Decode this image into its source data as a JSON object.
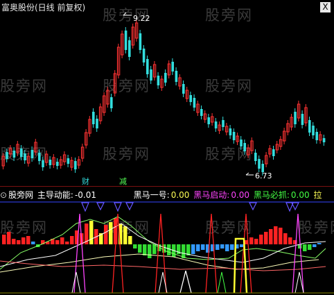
{
  "header": {
    "title": "富奥股份(日线 前复权)",
    "close_label": "X"
  },
  "watermark": "股旁网",
  "price_chart": {
    "high_label": "9.22",
    "low_label": "6.73",
    "event_labels": [
      "财",
      "减"
    ]
  },
  "indicator": {
    "collapse_icon": "⊙",
    "source": "股旁网",
    "name": "主导动能:",
    "value": "-0.01",
    "fields": [
      {
        "label": "黑马一号:",
        "value": "0.00",
        "color": "#ffffff"
      },
      {
        "label": "黑马启动:",
        "value": "0.00",
        "color": "#ff44ff"
      },
      {
        "label": "黑马必抓:",
        "value": "0.00",
        "color": "#44ff44"
      }
    ],
    "trailing": "拉"
  },
  "colors": {
    "up": "#ff3333",
    "down": "#33dddd",
    "background": "#000000"
  }
}
